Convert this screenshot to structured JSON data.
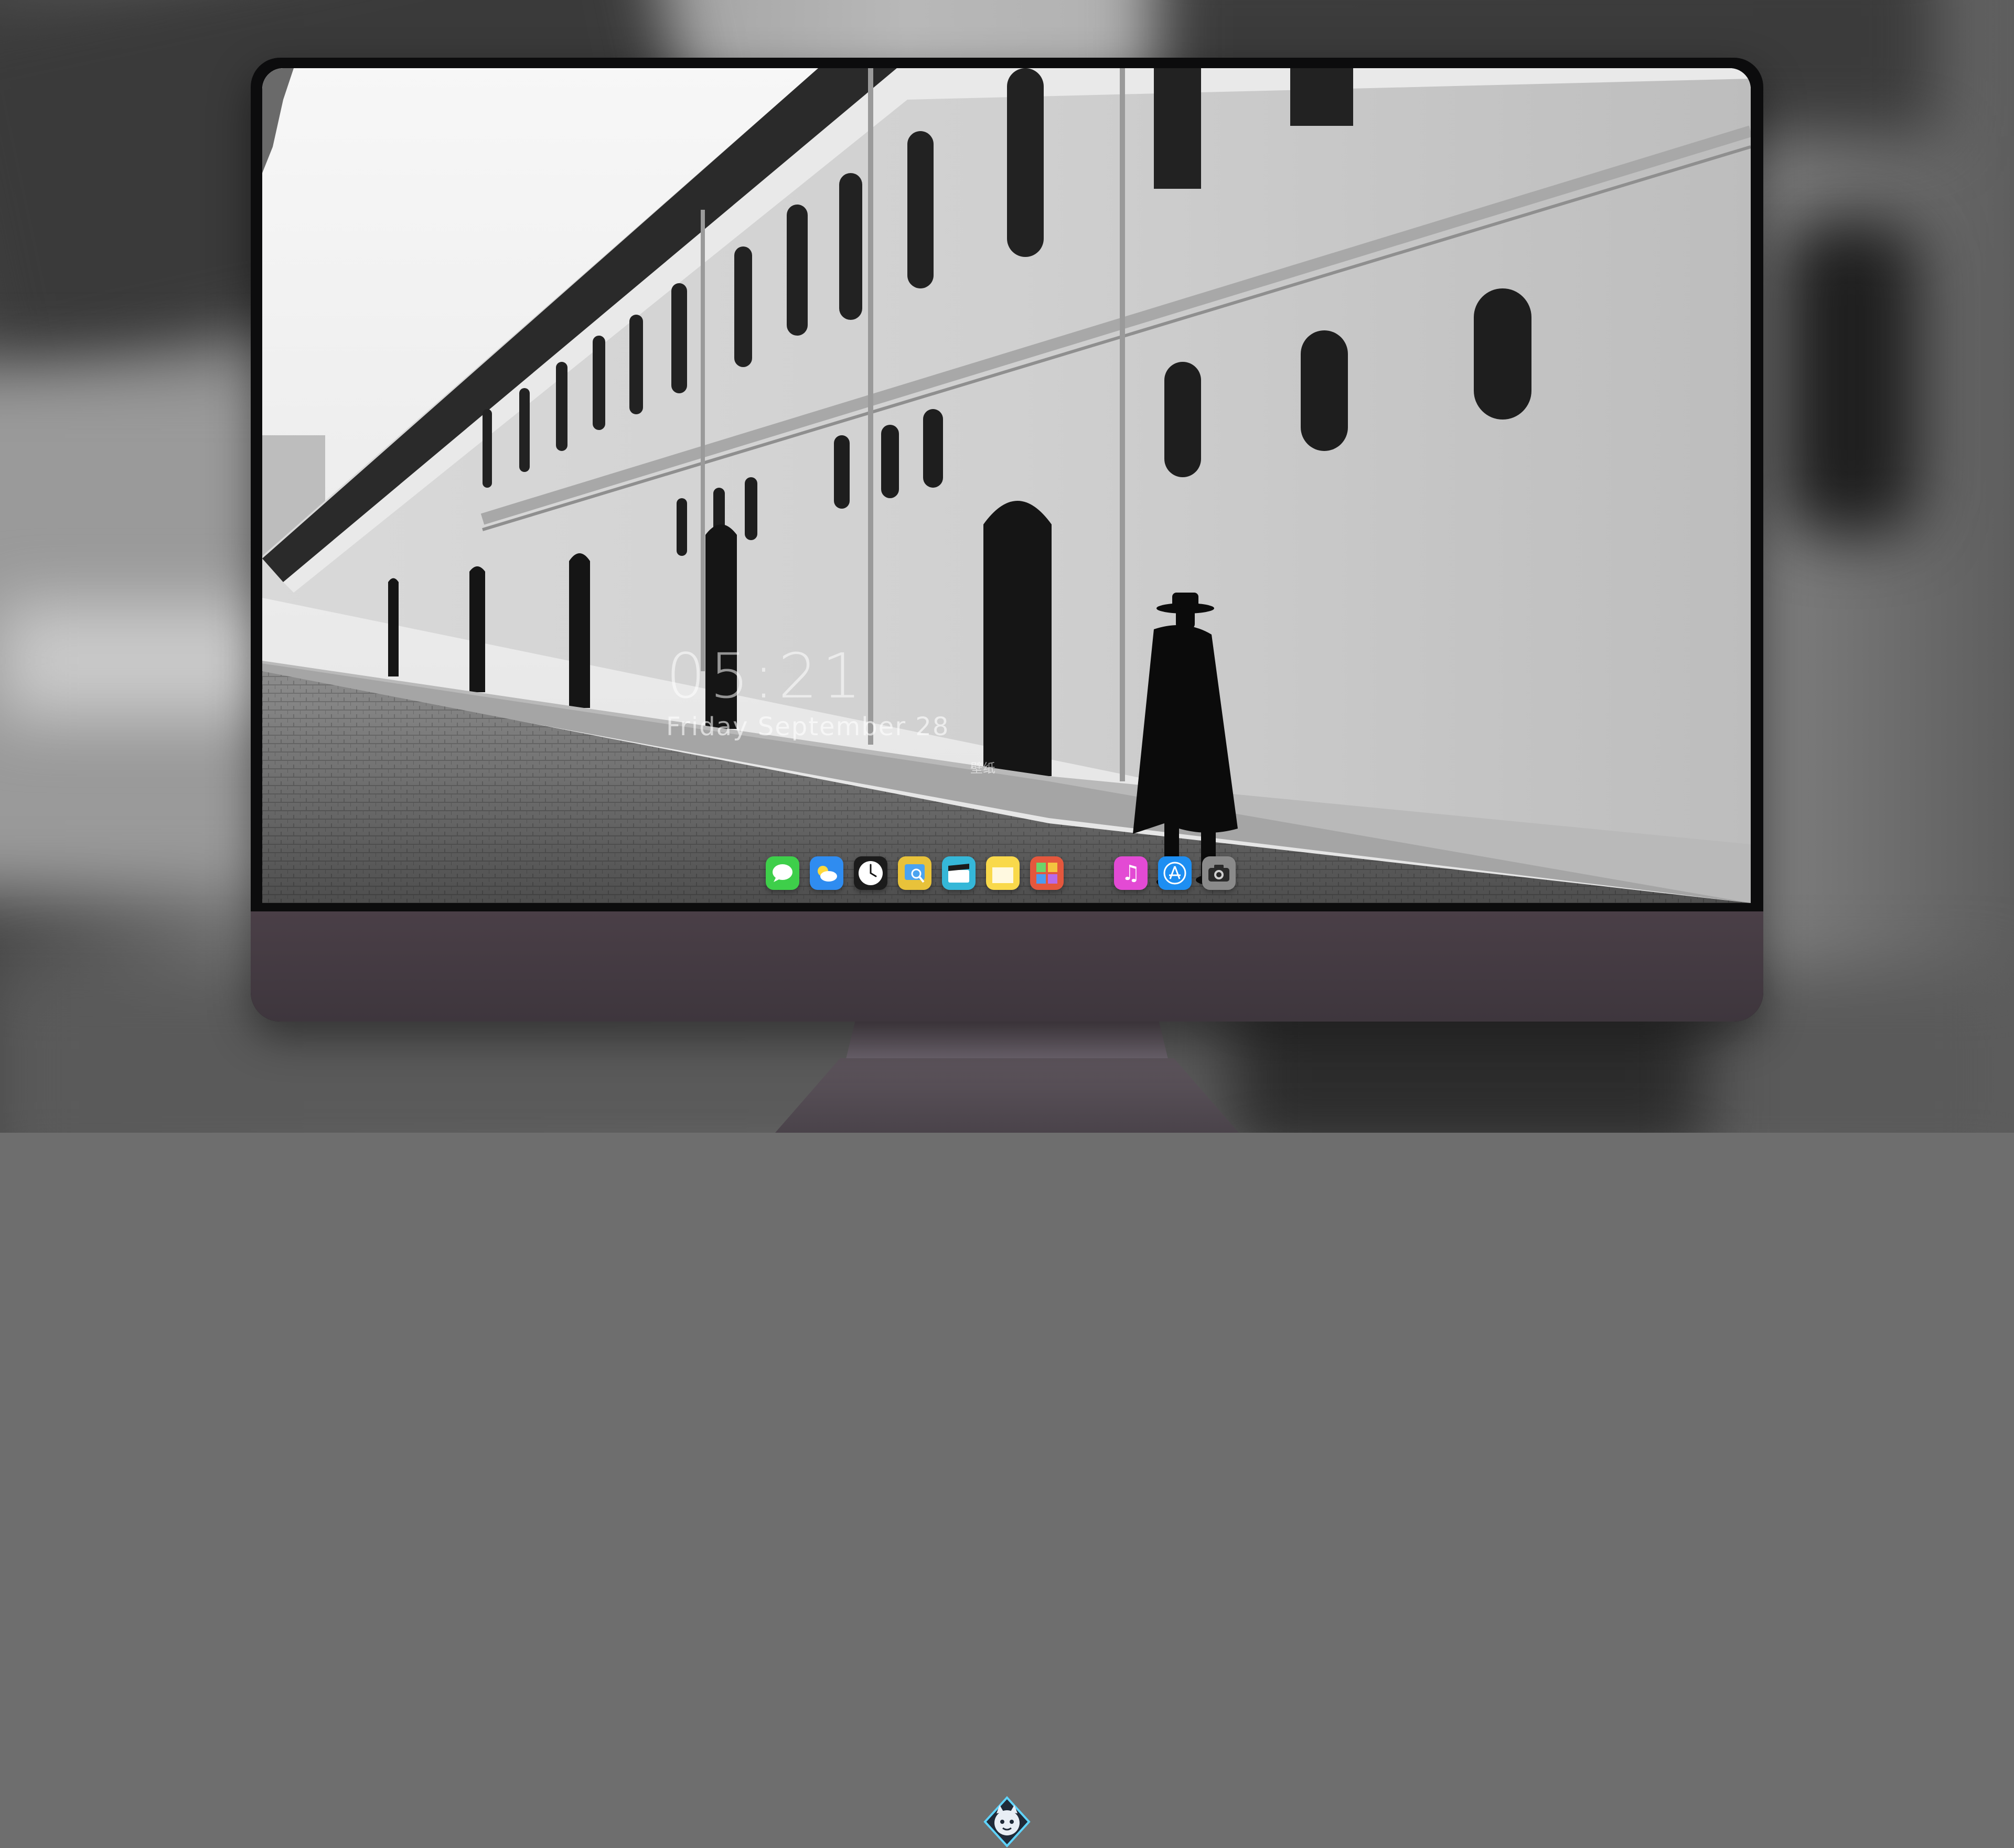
{
  "lockscreen": {
    "time": "05:21",
    "date": "Friday September 28",
    "wallpaper_label": "壁纸"
  },
  "dock": {
    "apps": [
      {
        "name": "Messages",
        "icon": "messages-icon",
        "color": "#3ecf4a"
      },
      {
        "name": "Weather",
        "icon": "weather-icon",
        "color": "#2f8cf0"
      },
      {
        "name": "Clock",
        "icon": "clock-icon",
        "color": "#1b1b1b"
      },
      {
        "name": "Preview",
        "icon": "preview-icon",
        "color": "#e8c23a"
      },
      {
        "name": "Clips",
        "icon": "clips-icon",
        "color": "#35b7d8"
      },
      {
        "name": "Notes",
        "icon": "notes-icon",
        "color": "#f9d94b"
      },
      {
        "name": "Photo Booth",
        "icon": "photo-booth-icon",
        "color": "#e4573d"
      },
      {
        "name": "Music",
        "icon": "music-icon",
        "color": "#e34ad4"
      },
      {
        "name": "App Store",
        "icon": "app-store-icon",
        "color": "#1d8ef2"
      },
      {
        "name": "Camera",
        "icon": "camera-icon",
        "color": "#8a8a8a"
      }
    ]
  },
  "monitor": {
    "logo_icon": "mascot-logo-icon",
    "chin_color": "#453b43"
  }
}
